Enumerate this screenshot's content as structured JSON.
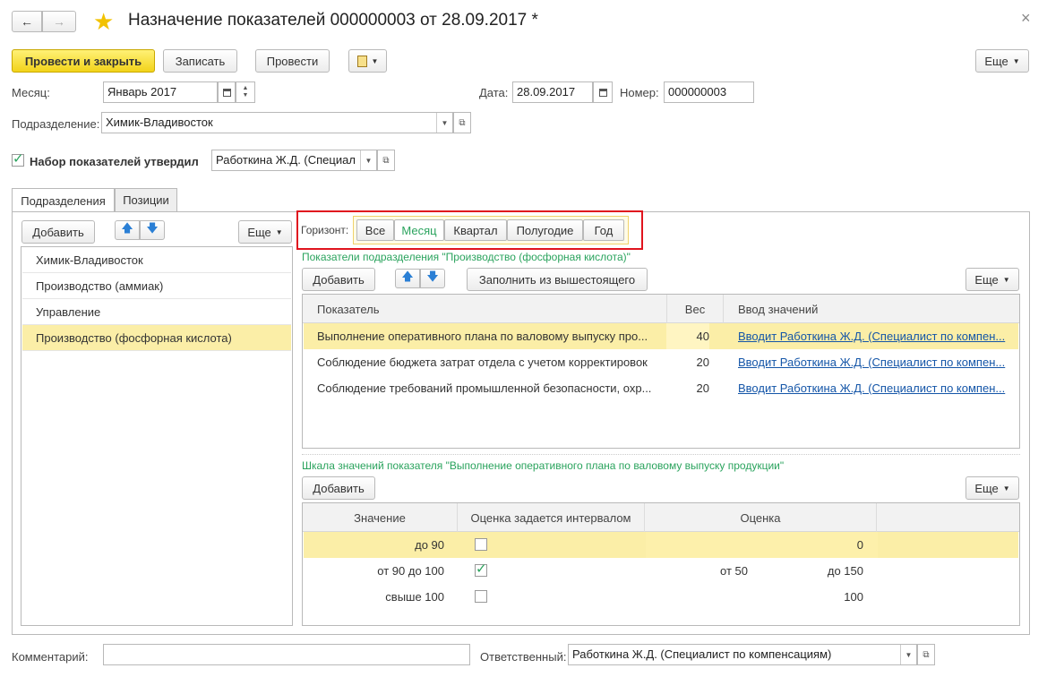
{
  "window": {
    "title": "Назначение показателей 000000003 от 28.09.2017 *",
    "close": "×"
  },
  "toolbar": {
    "post_close": "Провести и закрыть",
    "save": "Записать",
    "post": "Провести",
    "more": "Еще"
  },
  "form": {
    "month_label": "Месяц:",
    "month_value": "Январь 2017",
    "date_label": "Дата:",
    "date_value": "28.09.2017",
    "number_label": "Номер:",
    "number_value": "000000003",
    "division_label": "Подразделение:",
    "division_value": "Химик-Владивосток",
    "approved_label": "Набор показателей утвердил",
    "approved_value": "Работкина Ж.Д. (Специал",
    "approved_checked": true
  },
  "tabs": [
    "Подразделения",
    "Позиции"
  ],
  "left": {
    "add": "Добавить",
    "more": "Еще",
    "items": [
      "Химик-Владивосток",
      "Производство (аммиак)",
      "Управление",
      "Производство (фосфорная кислота)"
    ],
    "selected": 3
  },
  "horizon": {
    "label": "Горизонт:",
    "options": [
      "Все",
      "Месяц",
      "Квартал",
      "Полугодие",
      "Год"
    ],
    "selected": 1
  },
  "indicators": {
    "title": "Показатели подразделения \"Производство (фосфорная кислота)\"",
    "add": "Добавить",
    "fill": "Заполнить из вышестоящего",
    "more": "Еще",
    "columns": [
      "Показатель",
      "Вес",
      "Ввод значений"
    ],
    "rows": [
      {
        "name": "Выполнение оперативного плана по валовому выпуску про...",
        "weight": "40",
        "input": "Вводит Работкина Ж.Д. (Специалист по компен..."
      },
      {
        "name": "Соблюдение бюджета затрат отдела с учетом корректировок",
        "weight": "20",
        "input": "Вводит Работкина Ж.Д. (Специалист по компен..."
      },
      {
        "name": "Соблюдение требований промышленной безопасности, охр...",
        "weight": "20",
        "input": "Вводит Работкина Ж.Д. (Специалист по компен..."
      }
    ]
  },
  "scale": {
    "title": "Шкала значений показателя \"Выполнение оперативного плана по валовому выпуску продукции\"",
    "add": "Добавить",
    "more": "Еще",
    "columns": [
      "Значение",
      "Оценка задается интервалом",
      "Оценка"
    ],
    "rows": [
      {
        "value": "до 90",
        "interval": false,
        "from": "",
        "to": "",
        "score": "0"
      },
      {
        "value": "от 90 до 100",
        "interval": true,
        "from": "от 50",
        "to": "до 150",
        "score": ""
      },
      {
        "value": "свыше 100",
        "interval": false,
        "from": "",
        "to": "",
        "score": "100"
      }
    ]
  },
  "footer": {
    "comment_label": "Комментарий:",
    "comment_value": "",
    "responsible_label": "Ответственный:",
    "responsible_value": "Работкина Ж.Д. (Специалист по компенсациям)"
  },
  "colors": {
    "accent_yellow": "#f5d82a",
    "selection": "#fbeea7",
    "highlight_border": "#e0141e",
    "green": "#2aa35d",
    "link": "#1556a8"
  }
}
